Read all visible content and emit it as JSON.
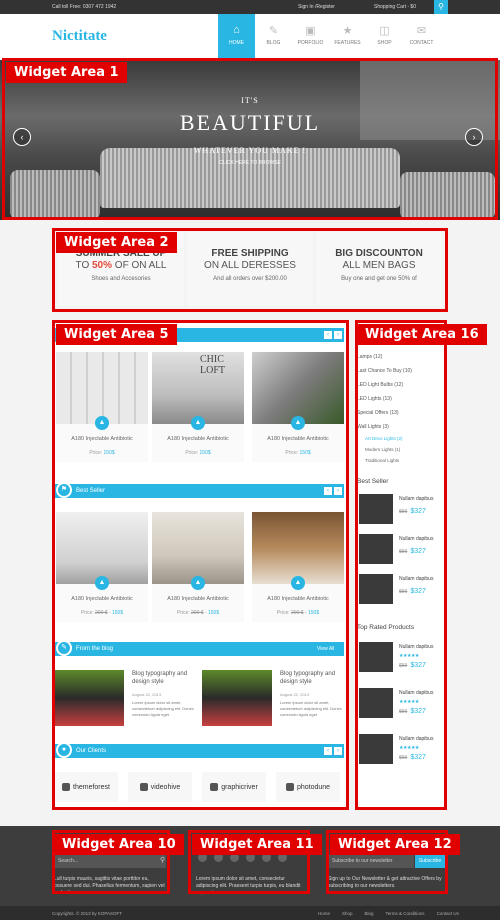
{
  "topbar": {
    "phone": "Call toll Free: 0307 472 1942",
    "signin": "Sign In /Register",
    "cart": "Shopping Cart - $0",
    "search_icon": "search-icon"
  },
  "logo": "Nictitate",
  "nav": [
    {
      "label": "HOME",
      "icon": "home-icon",
      "active": true
    },
    {
      "label": "BLOG",
      "icon": "pencil-icon"
    },
    {
      "label": "PORFOLIO",
      "icon": "camera-icon"
    },
    {
      "label": "FEATURES",
      "icon": "star-icon"
    },
    {
      "label": "SHOP",
      "icon": "gift-icon"
    },
    {
      "label": "CONTACT",
      "icon": "envelope-icon"
    }
  ],
  "slider": {
    "line1": "IT'S",
    "line2": "BEAUTIFUL",
    "line3": "WHATEVER YOU MAKE !",
    "line4": "CLICK HERE TO BROWSE"
  },
  "widget_labels": {
    "wa1": "Widget Area 1",
    "wa2": "Widget Area 2",
    "wa5": "Widget Area 5",
    "wa16": "Widget Area 16",
    "wa10": "Widget Area 10",
    "wa11": "Widget Area 11",
    "wa12": "Widget Area 12"
  },
  "promos": [
    {
      "title": "SUMMER SALE UP",
      "pre": "TO ",
      "highlight": "50%",
      "post": " OF ON ALL",
      "sub": "Shoes and Accesories"
    },
    {
      "title": "FREE SHIPPING",
      "pre": "ON ALL DERESSES",
      "highlight": "",
      "post": "",
      "sub": "And all orders over $200.00"
    },
    {
      "title": "BIG DISCOUNTON",
      "pre": "ALL MEN BAGS",
      "highlight": "",
      "post": "",
      "sub": "Buy one and get one 50% of"
    }
  ],
  "products_row1": [
    {
      "name": "A180 Injectable Antibiotic",
      "price_label": "Price: ",
      "price": "150$"
    },
    {
      "name": "A180 Injectable Antibiotic",
      "price_label": "Price: ",
      "price": "150$"
    },
    {
      "name": "A180 Injectable Antibiotic",
      "price_label": "Price: ",
      "price": "150$"
    }
  ],
  "image_overlay": "CHIC LOFT",
  "best_seller": {
    "title": "Best Seller"
  },
  "products_row2": [
    {
      "name": "A180 Injectable Antibiotic",
      "price_label": "Price: ",
      "old": "200 $",
      "price": "150$"
    },
    {
      "name": "A180 Injectable Antibiotic",
      "price_label": "Price: ",
      "old": "200 $",
      "price": "150$"
    },
    {
      "name": "A180 Injectable Antibiotic",
      "price_label": "Price: ",
      "old": "200 $",
      "price": "150$"
    }
  ],
  "blog": {
    "title": "From the blog",
    "view_all": "View All",
    "posts": [
      {
        "title": "Blog typography and design style",
        "date": "August 22, 2013",
        "text": "Lorem ipsum dolor sit amet, consectetuer adipiscing elit. Donec commodo ligula eget"
      },
      {
        "title": "Blog typography and design style",
        "date": "August 22, 2013",
        "text": "Lorem ipsum dolor sit amet, consectetuer adipiscing elit. Donec commodo ligula eget"
      }
    ]
  },
  "clients": {
    "title": "Our Clients",
    "items": [
      "themeforest",
      "videohive",
      "graphicriver",
      "photodune"
    ]
  },
  "sidebar": {
    "categories": [
      "Lamps (12)",
      "Last Chance To Buy (10)",
      "LED Light Bulbs (12)",
      "LED Lights (13)",
      "Special Offers (13)",
      "Wall Lights (3)"
    ],
    "subcategories": [
      "Art Deco Lights (2)",
      "Modern Lights (1)",
      "Traditional Lights"
    ],
    "best_seller_title": "Best Seller",
    "best_items": [
      {
        "name": "Nullam dapibus",
        "old": "$59",
        "new": "$327"
      },
      {
        "name": "Nullam dapibus",
        "old": "$59",
        "new": "$327"
      },
      {
        "name": "Nullam dapibus",
        "old": "$59",
        "new": "$327"
      }
    ],
    "top_rated_title": "Top Rated Products",
    "top_items": [
      {
        "name": "Nullam dapibus",
        "stars": "★★★★★",
        "old": "$59",
        "new": "$327"
      },
      {
        "name": "Nullam dapibus",
        "stars": "★★★★★",
        "old": "$59",
        "new": "$327"
      },
      {
        "name": "Nullam dapibus",
        "stars": "★★★★★",
        "old": "$59",
        "new": "$327"
      }
    ]
  },
  "footer": {
    "search_placeholder": "Search...",
    "text1": "Lull turpis mauris, sagittis vitae porttitor eu, posuere sed dui. Phasellus fermentum, sapien vel molestie",
    "text2": "Lorem ipsum dolor sit amet, consectetur adipiscing elit. Praesent turpis turpis, eu blandit ac, auctor",
    "newsletter_placeholder": "Subscribe to our newsletter",
    "subscribe": "Subscribe",
    "text3": "Sign up to Our Newsletter & get attractive Offers by subscribing to our newsletters."
  },
  "bottombar": {
    "copyright": "Copyrights. © 2013 by KOPASOFT",
    "links": [
      "Home",
      "Shop",
      "Blog",
      "Terms & Conditions",
      "Contact Us"
    ]
  },
  "colors": {
    "accent": "#29b6e3",
    "widget_red": "#e10000",
    "promo_red": "#e34b3c"
  }
}
